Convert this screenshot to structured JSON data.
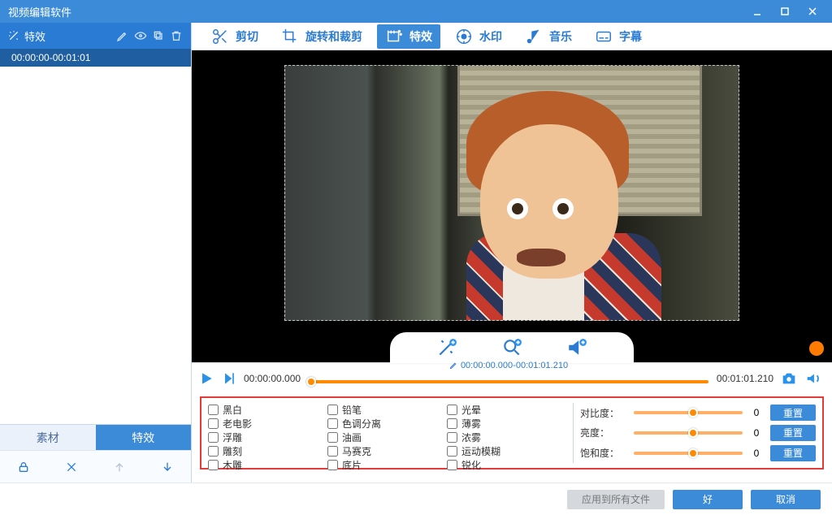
{
  "window": {
    "title": "视频编辑软件"
  },
  "sidebar": {
    "header_label": "特效",
    "clip_range": "00:00:00-00:01:01",
    "tabs": {
      "material": "素材",
      "effects": "特效"
    }
  },
  "toolbar": {
    "cut": "剪切",
    "rotate_crop": "旋转和裁剪",
    "effects": "特效",
    "watermark": "水印",
    "music": "音乐",
    "subtitle": "字幕"
  },
  "timeline": {
    "start": "00:00:00.000",
    "mid": "00:00:00.000-00:01:01.210",
    "end": "00:01:01.210"
  },
  "fx": {
    "checks": [
      "黑白",
      "铅笔",
      "光晕",
      "老电影",
      "色调分离",
      "薄雾",
      "浮雕",
      "油画",
      "浓雾",
      "雕刻",
      "马赛克",
      "运动模糊",
      "木雕",
      "底片",
      "锐化"
    ]
  },
  "sliders": {
    "rows": [
      {
        "label": "对比度：",
        "value": "0",
        "reset": "重置"
      },
      {
        "label": "亮度：",
        "value": "0",
        "reset": "重置"
      },
      {
        "label": "饱和度：",
        "value": "0",
        "reset": "重置"
      }
    ]
  },
  "bottombar": {
    "apply_all": "应用到所有文件",
    "ok": "好",
    "cancel": "取消"
  }
}
